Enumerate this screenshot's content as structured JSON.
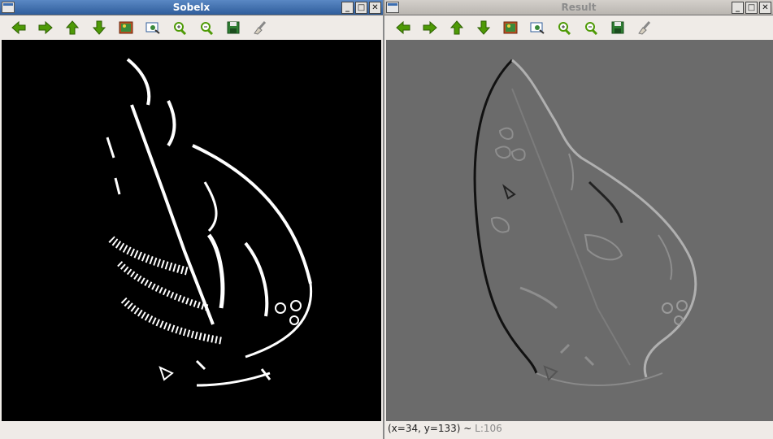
{
  "windows": {
    "left": {
      "title": "Sobelx"
    },
    "right": {
      "title": "Result",
      "status_text": "(x=34, y=133) ~ ",
      "status_l": "L:106"
    }
  },
  "window_buttons": {
    "minimize": "_",
    "maximize": "□",
    "close": "✕"
  },
  "toolbar_icons": [
    "arrow-left-icon",
    "arrow-right-icon",
    "arrow-up-icon",
    "arrow-down-icon",
    "image-icon",
    "zoom-fit-icon",
    "zoom-in-icon",
    "zoom-out-icon",
    "save-icon",
    "clear-brush-icon"
  ],
  "colors": {
    "icon_green": "#4e9a06",
    "left_title_bg": "#3b6db0",
    "left_canvas": "#000000",
    "right_canvas": "#6b6b6b"
  }
}
